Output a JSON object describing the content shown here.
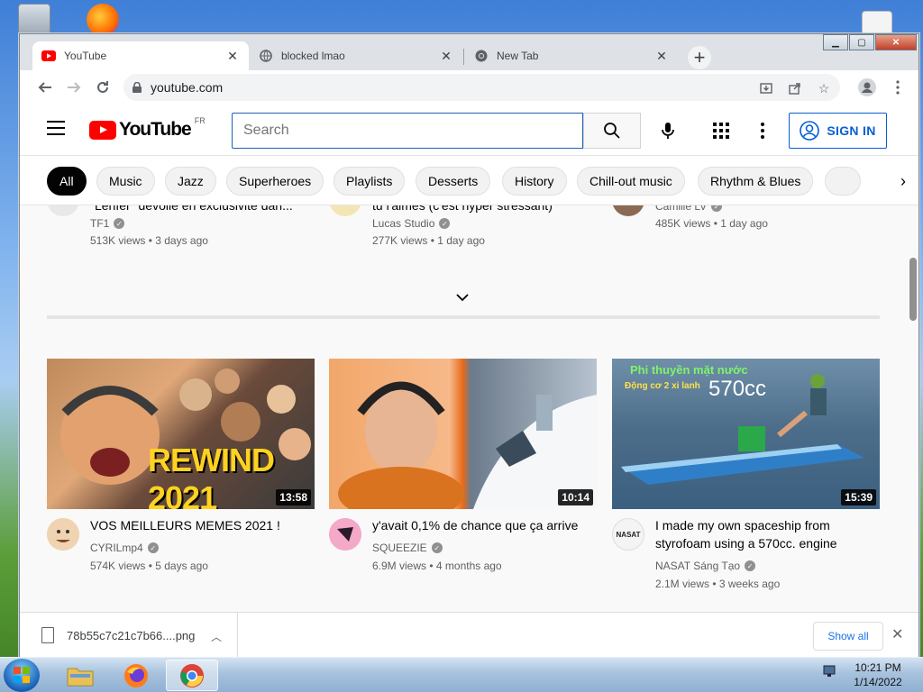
{
  "browser": {
    "tabs": [
      {
        "label": "YouTube",
        "active": true
      },
      {
        "label": "blocked lmao",
        "active": false
      },
      {
        "label": "New Tab",
        "active": false
      }
    ],
    "new_tab_glyph": "+",
    "url": "youtube.com"
  },
  "youtube": {
    "logo_text": "YouTube",
    "country_code": "FR",
    "search_placeholder": "Search",
    "sign_in_label": "SIGN IN",
    "chips": [
      "All",
      "Music",
      "Jazz",
      "Superheroes",
      "Playlists",
      "Desserts",
      "History",
      "Chill-out music",
      "Rhythm & Blues"
    ],
    "top_row": [
      {
        "title": "\"Lenfer\" dévoilé en exclusivité dan...",
        "channel": "TF1",
        "meta": "513K views • 3 days ago"
      },
      {
        "title": "tu l'aimes (c'est hyper stressant)",
        "channel": "Lucas Studio",
        "meta": "277K views • 1 day ago"
      },
      {
        "title": "",
        "channel": "Camille LV",
        "meta": "485K views • 1 day ago"
      }
    ],
    "videos": [
      {
        "title": "VOS MEILLEURS MEMES 2021 !",
        "channel": "CYRILmp4",
        "meta": "574K views • 5 days ago",
        "duration": "13:58",
        "thumb_text": "REWIND 2021"
      },
      {
        "title": "y'avait 0,1% de chance que ça arrive",
        "channel": "SQUEEZIE",
        "meta": "6.9M views • 4 months ago",
        "duration": "10:14"
      },
      {
        "title": "I made my own spaceship from styrofoam using a 570cc. engine",
        "channel": "NASAT Sáng Tạo",
        "meta": "2.1M views • 3 weeks ago",
        "duration": "15:39",
        "thumb_text": "Phi thuyền mặt nước",
        "thumb_subtext": "Động cơ 2 xi lanh",
        "thumb_big": "570cc",
        "avatar_text": "NASAT"
      }
    ]
  },
  "downloads": {
    "file_name": "78b55c7c21c7b66....png",
    "show_all_label": "Show all"
  },
  "taskbar": {
    "time": "10:21 PM",
    "date": "1/14/2022"
  },
  "colors": {
    "youtube_red": "#ff0000",
    "link_blue": "#065fd4",
    "chip_active": "#030303"
  }
}
